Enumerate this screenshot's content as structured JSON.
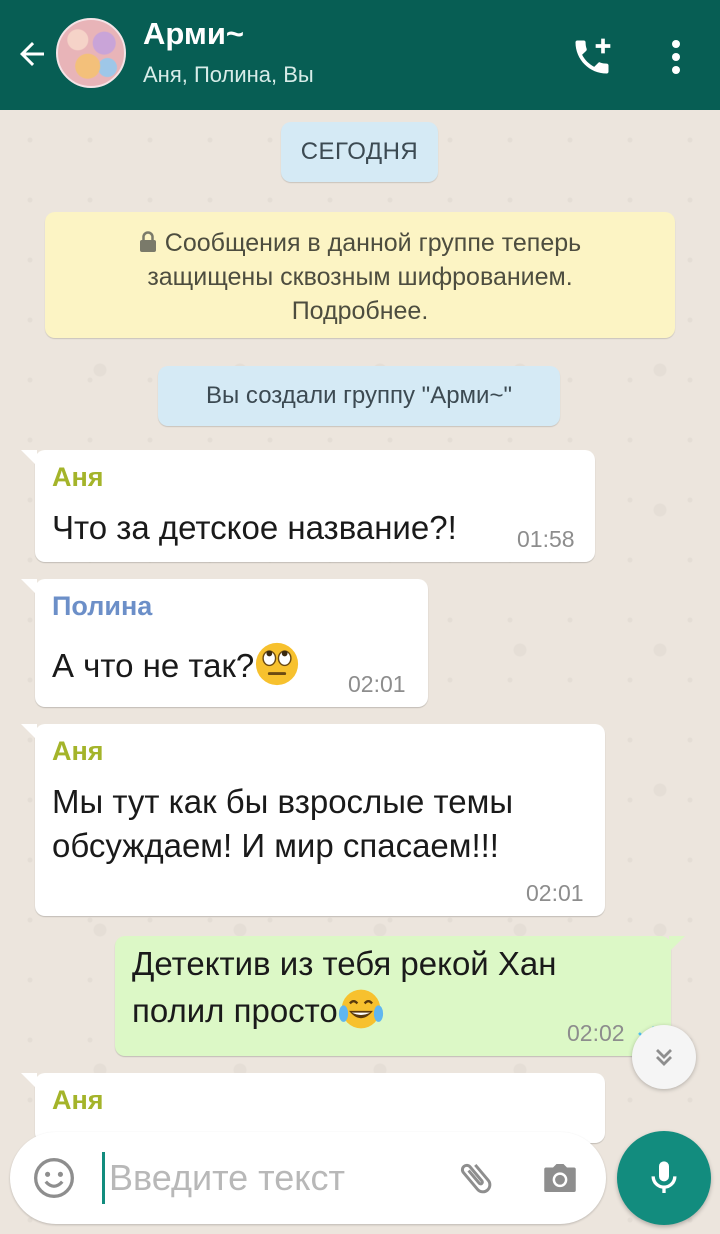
{
  "header": {
    "title": "Арми~",
    "subtitle": "Аня, Полина, Вы",
    "back_icon": "arrow-back-icon",
    "call_icon": "add-call-icon",
    "menu_icon": "more-vert-icon"
  },
  "chat": {
    "date_label": "СЕГОДНЯ",
    "encryption_line1": "Сообщения в данной группе теперь",
    "encryption_line2": "защищены сквозным шифрованием.",
    "encryption_line3": "Подробнее.",
    "system_message": "Вы создали группу \"Арми~\"",
    "messages": [
      {
        "sender": "Аня",
        "text": "Что за детское название?!",
        "time": "01:58"
      },
      {
        "sender": "Полина",
        "text": "А что не так?",
        "emoji": "face-with-rolling-eyes",
        "time": "02:01"
      },
      {
        "sender": "Аня",
        "text_line1": "Мы тут как бы взрослые темы",
        "text_line2": "обсуждаем! И мир спасаем!!!",
        "time": "02:01"
      },
      {
        "sender": "Вы",
        "text_line1": "Детектив из тебя рекой Хан",
        "text_line2": "полил просто",
        "emoji": "face-with-tears-of-joy",
        "time": "02:02",
        "status": "read"
      },
      {
        "sender": "Аня"
      }
    ]
  },
  "composer": {
    "placeholder": "Введите текст",
    "emoji_icon": "emoji-icon",
    "attach_icon": "paperclip-icon",
    "camera_icon": "camera-icon",
    "mic_icon": "mic-icon"
  },
  "colors": {
    "header_bg": "#075e54",
    "accent": "#128c7e",
    "outgoing_bubble": "#dcf8c6",
    "sender_anya": "#a4b42a",
    "sender_polina": "#6c8fc8",
    "read_ticks": "#4fc3f7"
  }
}
